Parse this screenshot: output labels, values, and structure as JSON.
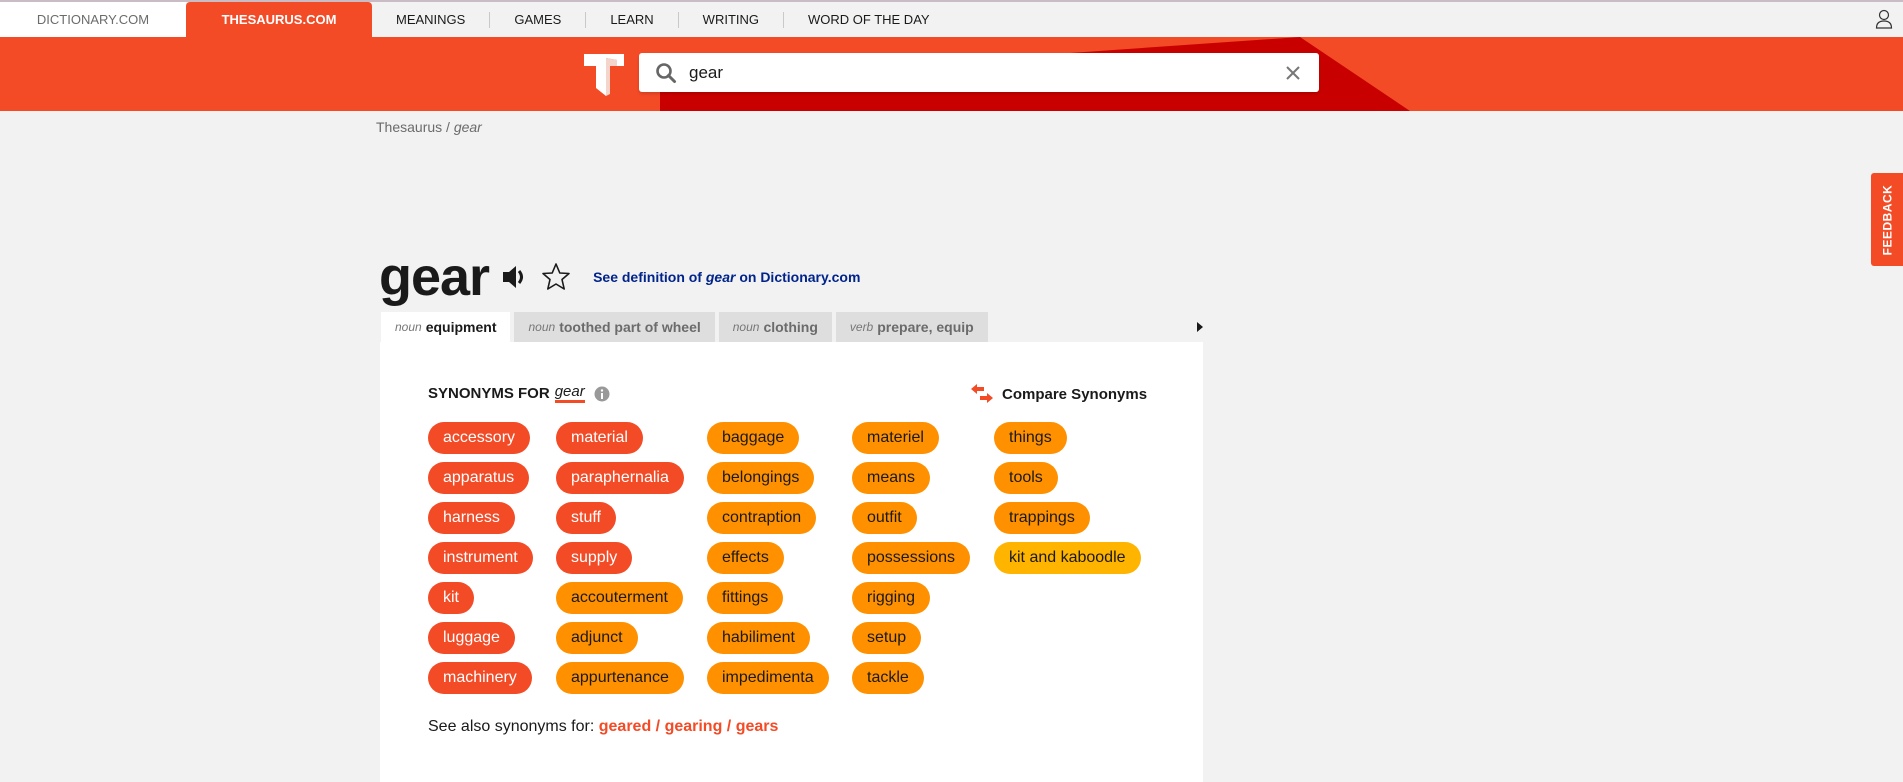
{
  "topbar": {
    "dictionary_tab": "DICTIONARY.COM",
    "thesaurus_tab": "THESAURUS.COM",
    "nav": [
      "MEANINGS",
      "GAMES",
      "LEARN",
      "WRITING",
      "WORD OF THE DAY"
    ],
    "user_icon": "user-icon"
  },
  "search": {
    "value": "gear",
    "icon": "search-icon",
    "clear_icon": "close-icon"
  },
  "breadcrumb": {
    "root": "Thesaurus",
    "separator": " / ",
    "current": "gear"
  },
  "feedback_label": "FEEDBACK",
  "entry": {
    "word": "gear",
    "definition_link": {
      "prefix": "See definition of ",
      "word": "gear",
      "suffix": " on Dictionary.com"
    }
  },
  "tabs": [
    {
      "pos": "noun",
      "label": "equipment",
      "active": true
    },
    {
      "pos": "noun",
      "label": "toothed part of wheel",
      "active": false
    },
    {
      "pos": "noun",
      "label": "clothing",
      "active": false
    },
    {
      "pos": "verb",
      "label": "prepare, equip",
      "active": false
    }
  ],
  "synonyms": {
    "heading": "SYNONYMS FOR",
    "word": "gear",
    "compare_label": "Compare Synonyms",
    "columns": [
      [
        {
          "word": "accessory",
          "strength": "strongest"
        },
        {
          "word": "apparatus",
          "strength": "strongest"
        },
        {
          "word": "harness",
          "strength": "strongest"
        },
        {
          "word": "instrument",
          "strength": "strongest"
        },
        {
          "word": "kit",
          "strength": "strongest"
        },
        {
          "word": "luggage",
          "strength": "strongest"
        },
        {
          "word": "machinery",
          "strength": "strongest"
        }
      ],
      [
        {
          "word": "material",
          "strength": "strongest"
        },
        {
          "word": "paraphernalia",
          "strength": "strongest"
        },
        {
          "word": "stuff",
          "strength": "strongest"
        },
        {
          "word": "supply",
          "strength": "strongest"
        },
        {
          "word": "accouterment",
          "strength": "strong"
        },
        {
          "word": "adjunct",
          "strength": "strong"
        },
        {
          "word": "appurtenance",
          "strength": "strong"
        }
      ],
      [
        {
          "word": "baggage",
          "strength": "strong"
        },
        {
          "word": "belongings",
          "strength": "strong"
        },
        {
          "word": "contraption",
          "strength": "strong"
        },
        {
          "word": "effects",
          "strength": "strong"
        },
        {
          "word": "fittings",
          "strength": "strong"
        },
        {
          "word": "habiliment",
          "strength": "strong"
        },
        {
          "word": "impedimenta",
          "strength": "strong"
        }
      ],
      [
        {
          "word": "materiel",
          "strength": "strong"
        },
        {
          "word": "means",
          "strength": "strong"
        },
        {
          "word": "outfit",
          "strength": "strong"
        },
        {
          "word": "possessions",
          "strength": "strong"
        },
        {
          "word": "rigging",
          "strength": "strong"
        },
        {
          "word": "setup",
          "strength": "strong"
        },
        {
          "word": "tackle",
          "strength": "strong"
        }
      ],
      [
        {
          "word": "things",
          "strength": "strong"
        },
        {
          "word": "tools",
          "strength": "strong"
        },
        {
          "word": "trappings",
          "strength": "strong"
        },
        {
          "word": "kit and kaboodle",
          "strength": "weak"
        }
      ]
    ],
    "colors": {
      "strongest": "#f44b27",
      "strong": "#ff9100",
      "weak": "#ffb400"
    }
  },
  "see_also": {
    "label": "See also synonyms for: ",
    "links": [
      "geared",
      "gearing",
      "gears"
    ]
  },
  "colors": {
    "brand": "#f44b27",
    "brand_dark": "#c90000",
    "link_blue": "#00248b"
  }
}
